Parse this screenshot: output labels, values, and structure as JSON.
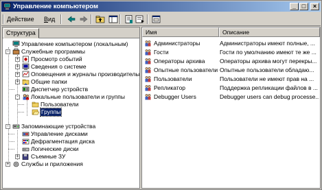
{
  "window": {
    "title": "Управление компьютером",
    "buttons": {
      "minimize": "_",
      "maximize": "□",
      "close": "×"
    }
  },
  "menu": {
    "action_pre": "",
    "action_u": "Д",
    "action_post": "ействие",
    "view_pre": "",
    "view_u": "В",
    "view_post": "ид"
  },
  "toolbar_icons": [
    "back-arrow-icon",
    "forward-arrow-icon",
    "up-folder-icon",
    "show-tree-icon",
    "properties-icon",
    "export-list-icon",
    "help-icon"
  ],
  "left_pane": {
    "tab_label": "Структура",
    "tree": [
      {
        "label": "Управление компьютером (локальным)",
        "icon": "computer-management-icon",
        "expander": ""
      },
      {
        "label": "Служебные программы",
        "icon": "tools-icon",
        "expander": "-"
      },
      {
        "label": "Просмотр событий",
        "icon": "event-viewer-icon",
        "expander": "+"
      },
      {
        "label": "Сведения о системе",
        "icon": "system-info-icon",
        "expander": "+"
      },
      {
        "label": "Оповещения и журналы производительн",
        "icon": "performance-logs-icon",
        "expander": "+"
      },
      {
        "label": "Общие папки",
        "icon": "shared-folders-icon",
        "expander": "+"
      },
      {
        "label": "Диспетчер устройств",
        "icon": "device-manager-icon",
        "expander": ""
      },
      {
        "label": "Локальные пользователи и группы",
        "icon": "local-users-icon",
        "expander": "-"
      },
      {
        "label": "Пользователи",
        "icon": "folder-icon",
        "expander": ""
      },
      {
        "label": "Группы",
        "icon": "open-folder-icon",
        "expander": "",
        "selected": true
      },
      {
        "label": "Запоминающие устройства",
        "icon": "storage-icon",
        "expander": "-"
      },
      {
        "label": "Управление дисками",
        "icon": "disk-management-icon",
        "expander": ""
      },
      {
        "label": "Дефрагментация диска",
        "icon": "defrag-icon",
        "expander": ""
      },
      {
        "label": "Логические диски",
        "icon": "logical-drives-icon",
        "expander": ""
      },
      {
        "label": "Съемные ЗУ",
        "icon": "removable-storage-icon",
        "expander": "+"
      },
      {
        "label": "Службы и приложения",
        "icon": "services-icon",
        "expander": "+"
      }
    ]
  },
  "right_pane": {
    "columns": [
      "Имя",
      "Описание"
    ],
    "rows": [
      {
        "name": "Администраторы",
        "desc": "Администраторы имеют полные, ..."
      },
      {
        "name": "Гости",
        "desc": "Гости по умолчанию имеют те же ..."
      },
      {
        "name": "Операторы архива",
        "desc": "Операторы архива могут перекры..."
      },
      {
        "name": "Опытные пользователи",
        "desc": "Опытные пользователи обладаю..."
      },
      {
        "name": "Пользователи",
        "desc": "Пользователи не имеют прав на ..."
      },
      {
        "name": "Репликатор",
        "desc": "Поддержка репликации файлов в ..."
      },
      {
        "name": "Debugger Users",
        "desc": "Debugger users can debug processe..."
      }
    ]
  },
  "colors": {
    "title_start": "#0a246a",
    "title_end": "#a6caf0",
    "selection": "#0a246a",
    "chrome": "#d4d0c8"
  }
}
